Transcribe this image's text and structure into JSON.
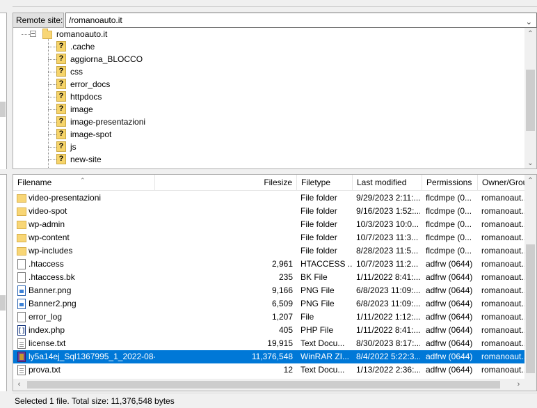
{
  "remote": {
    "label": "Remote site:",
    "path": "/romanoauto.it"
  },
  "tree": {
    "root": "romanoauto.it",
    "children": [
      ".cache",
      "aggiorna_BLOCCO",
      "css",
      "error_docs",
      "httpdocs",
      "image",
      "image-presentazioni",
      "image-spot",
      "js",
      "new-site"
    ],
    "unknown_icon": "?"
  },
  "list": {
    "columns": {
      "filename": "Filename",
      "filesize": "Filesize",
      "filetype": "Filetype",
      "last_modified": "Last modified",
      "permissions": "Permissions",
      "owner": "Owner/Grou"
    },
    "rows": [
      {
        "name": "video-presentazioni",
        "size": "",
        "type": "File folder",
        "modified": "9/29/2023 2:11:...",
        "perm": "flcdmpe (0...",
        "owner": "romanoaut...",
        "icon": "folder-icon"
      },
      {
        "name": "video-spot",
        "size": "",
        "type": "File folder",
        "modified": "9/16/2023 1:52:...",
        "perm": "flcdmpe (0...",
        "owner": "romanoaut...",
        "icon": "folder-icon"
      },
      {
        "name": "wp-admin",
        "size": "",
        "type": "File folder",
        "modified": "10/3/2023 10:0...",
        "perm": "flcdmpe (0...",
        "owner": "romanoaut...",
        "icon": "folder-icon"
      },
      {
        "name": "wp-content",
        "size": "",
        "type": "File folder",
        "modified": "10/7/2023 11:3...",
        "perm": "flcdmpe (0...",
        "owner": "romanoaut...",
        "icon": "folder-icon"
      },
      {
        "name": "wp-includes",
        "size": "",
        "type": "File folder",
        "modified": "8/28/2023 11:5...",
        "perm": "flcdmpe (0...",
        "owner": "romanoaut...",
        "icon": "folder-icon"
      },
      {
        "name": ".htaccess",
        "size": "2,961",
        "type": "HTACCESS ...",
        "modified": "10/7/2023 11:2...",
        "perm": "adfrw (0644)",
        "owner": "romanoaut...",
        "icon": "file-icon"
      },
      {
        "name": ".htaccess.bk",
        "size": "235",
        "type": "BK File",
        "modified": "1/11/2022 8:41:...",
        "perm": "adfrw (0644)",
        "owner": "romanoaut...",
        "icon": "file-icon"
      },
      {
        "name": "Banner.png",
        "size": "9,166",
        "type": "PNG File",
        "modified": "6/8/2023 11:09:...",
        "perm": "adfrw (0644)",
        "owner": "romanoaut...",
        "icon": "image-file-icon"
      },
      {
        "name": "Banner2.png",
        "size": "6,509",
        "type": "PNG File",
        "modified": "6/8/2023 11:09:...",
        "perm": "adfrw (0644)",
        "owner": "romanoaut...",
        "icon": "image-file-icon"
      },
      {
        "name": "error_log",
        "size": "1,207",
        "type": "File",
        "modified": "1/11/2022 1:12:...",
        "perm": "adfrw (0644)",
        "owner": "romanoaut...",
        "icon": "file-icon"
      },
      {
        "name": "index.php",
        "size": "405",
        "type": "PHP File",
        "modified": "1/11/2022 8:41:...",
        "perm": "adfrw (0644)",
        "owner": "romanoaut...",
        "icon": "php-file-icon"
      },
      {
        "name": "license.txt",
        "size": "19,915",
        "type": "Text Docu...",
        "modified": "8/30/2023 8:17:...",
        "perm": "adfrw (0644)",
        "owner": "romanoaut...",
        "icon": "text-file-icon"
      },
      {
        "name": "ly5a14ej_Sql1367995_1_2022-08-...",
        "size": "11,376,548",
        "type": "WinRAR ZI...",
        "modified": "8/4/2022 5:22:3...",
        "perm": "adfrw (0644)",
        "owner": "romanoaut...",
        "icon": "archive-icon",
        "selected": true
      },
      {
        "name": "prova.txt",
        "size": "12",
        "type": "Text Docu...",
        "modified": "1/13/2022 2:36:...",
        "perm": "adfrw (0644)",
        "owner": "romanoaut...",
        "icon": "text-file-icon"
      }
    ]
  },
  "status": {
    "text": "Selected 1 file. Total size: 11,376,548 bytes"
  }
}
